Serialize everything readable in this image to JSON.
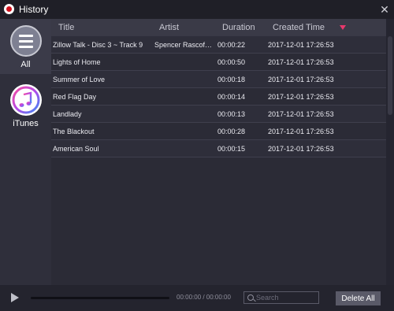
{
  "window": {
    "title": "History",
    "close_glyph": "✕",
    "icon": "app-record-icon"
  },
  "sidebar": {
    "items": [
      {
        "label": "All",
        "icon": "menu-icon",
        "active": true
      },
      {
        "label": "iTunes",
        "icon": "itunes-icon",
        "active": false
      }
    ]
  },
  "table": {
    "columns": [
      "Title",
      "Artist",
      "Duration",
      "Created Time"
    ],
    "sort": {
      "column": "Created Time",
      "direction": "descending"
    },
    "rows": [
      {
        "title": "Zillow Talk - Disc 3 ~ Track 9",
        "artist": "Spencer Rascoff ...",
        "duration": "00:00:22",
        "created": "2017-12-01 17:26:53"
      },
      {
        "title": "Lights of Home",
        "artist": "",
        "duration": "00:00:50",
        "created": "2017-12-01 17:26:53"
      },
      {
        "title": "Summer of Love",
        "artist": "",
        "duration": "00:00:18",
        "created": "2017-12-01 17:26:53"
      },
      {
        "title": "Red Flag Day",
        "artist": "",
        "duration": "00:00:14",
        "created": "2017-12-01 17:26:53"
      },
      {
        "title": "Landlady",
        "artist": "",
        "duration": "00:00:13",
        "created": "2017-12-01 17:26:53"
      },
      {
        "title": "The Blackout",
        "artist": "",
        "duration": "00:00:28",
        "created": "2017-12-01 17:26:53"
      },
      {
        "title": "American Soul",
        "artist": "",
        "duration": "00:00:15",
        "created": "2017-12-01 17:26:53"
      }
    ]
  },
  "player": {
    "time": "00:00:00 / 00:00:00",
    "progress": 0
  },
  "search": {
    "placeholder": "Search",
    "value": ""
  },
  "actions": {
    "delete_all_label": "Delete All"
  },
  "colors": {
    "accent": "#e8386c",
    "background": "#2b2b36"
  }
}
